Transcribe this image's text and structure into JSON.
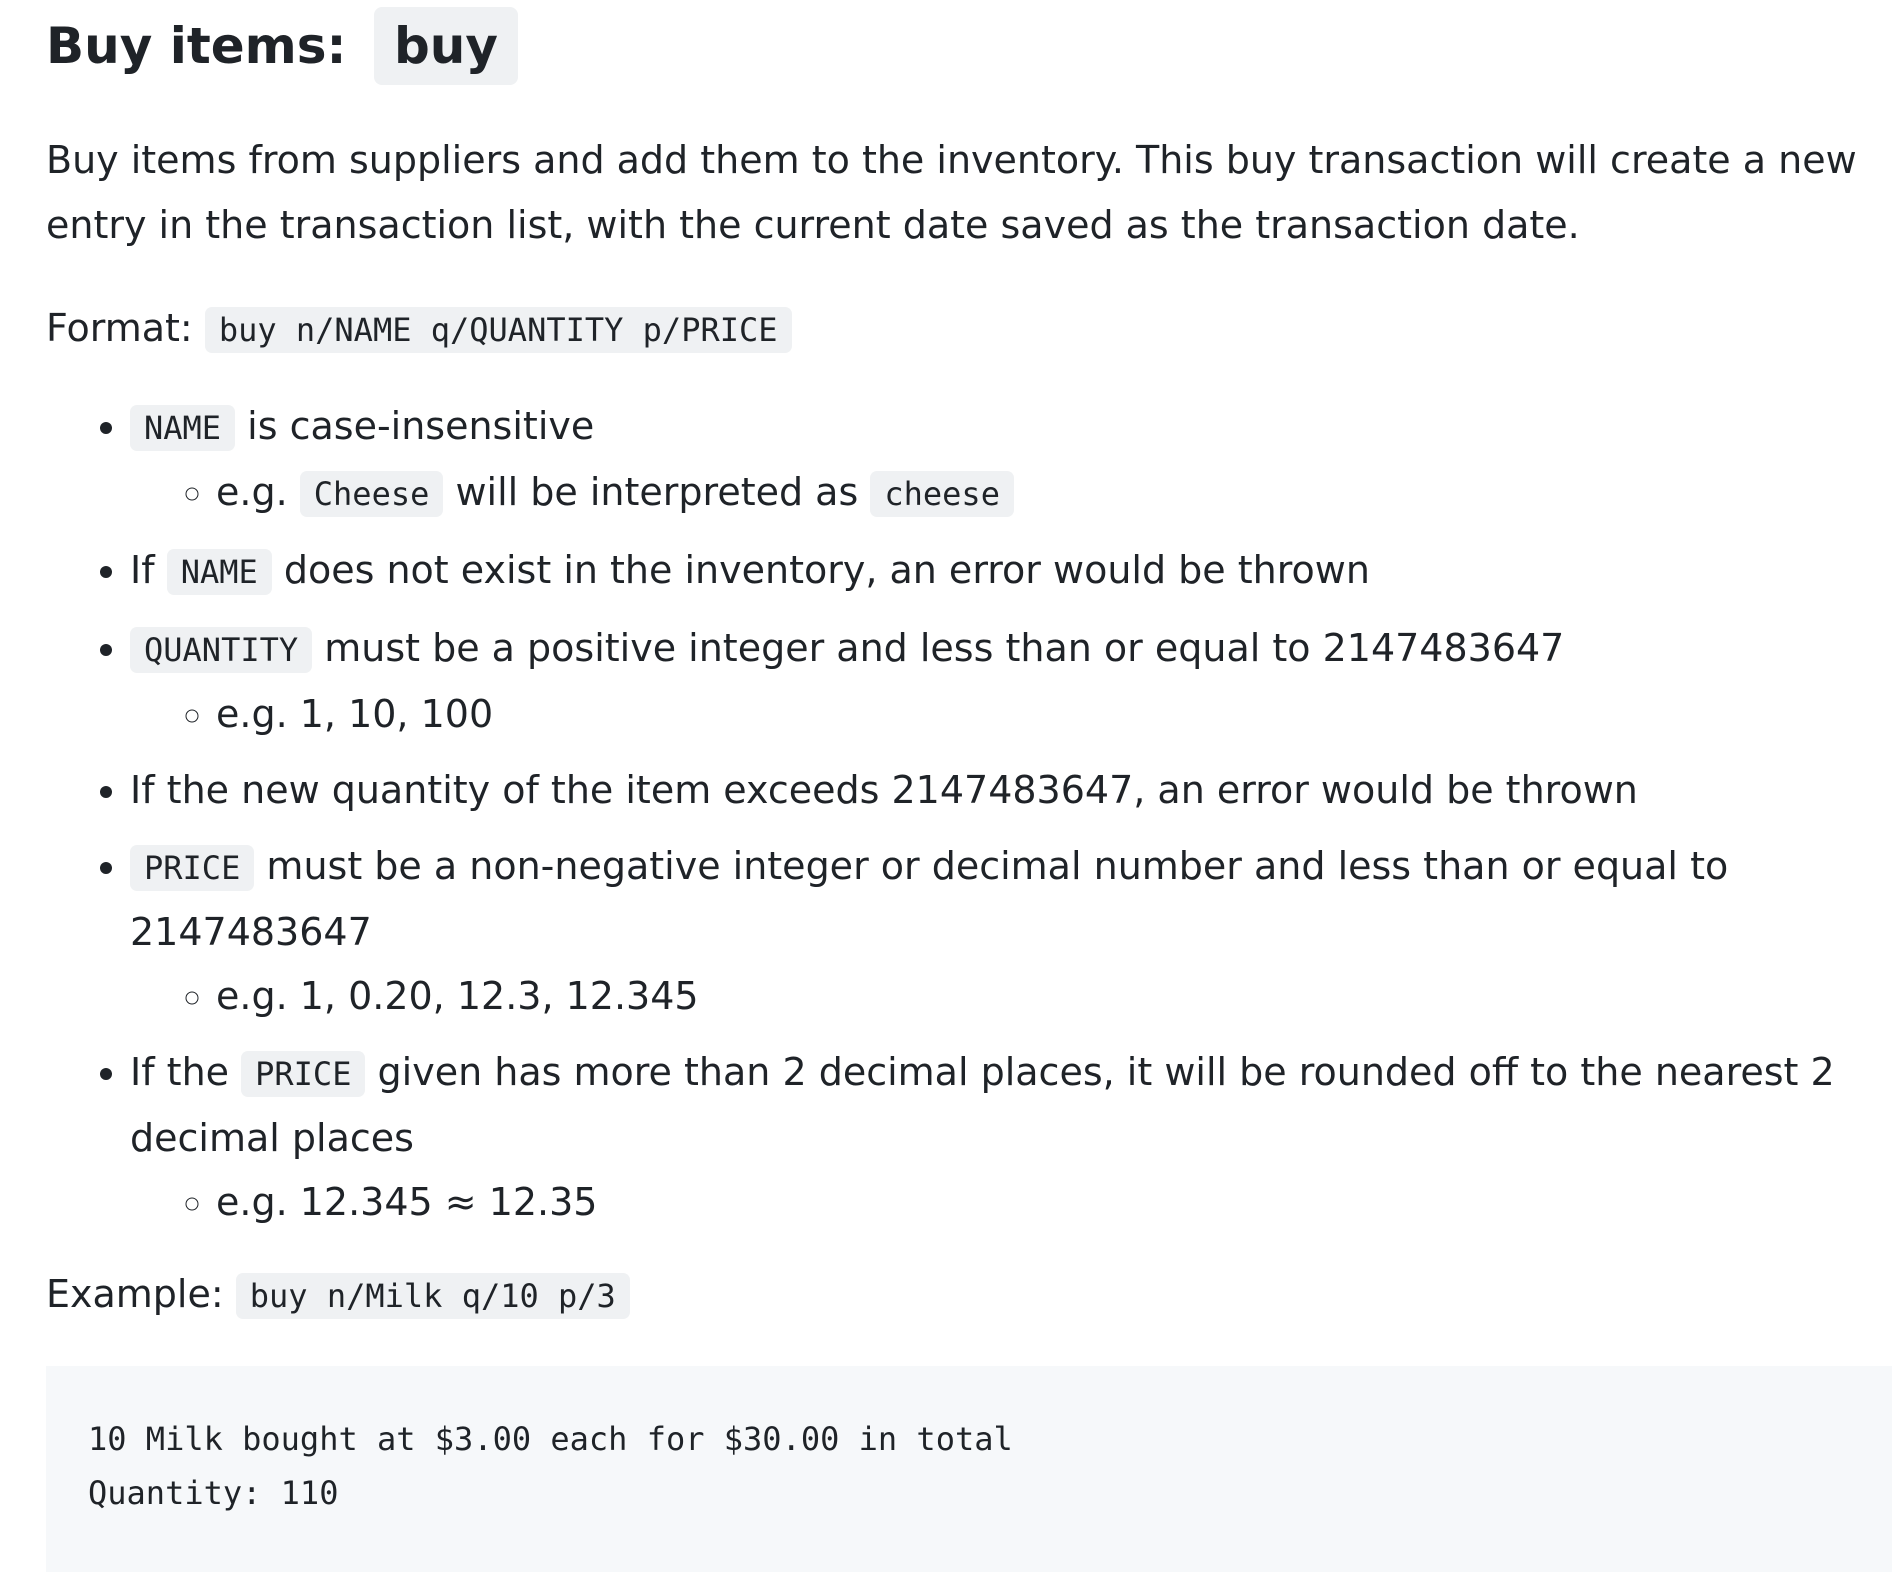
{
  "heading": {
    "text": "Buy items:",
    "command": "buy"
  },
  "description": "Buy items from suppliers and add them to the inventory. This buy transaction will create a new entry in the transaction list, with the current date saved as the transaction date.",
  "format": {
    "label": "Format:",
    "code": "buy n/NAME q/QUANTITY p/PRICE"
  },
  "bullets": {
    "b1": {
      "code": "NAME",
      "text": "is case-insensitive",
      "sub": {
        "prefix": "e.g.",
        "code1": "Cheese",
        "middle": "will be interpreted as",
        "code2": "cheese"
      }
    },
    "b2": {
      "prefix": "If",
      "code": "NAME",
      "text": "does not exist in the inventory, an error would be thrown"
    },
    "b3": {
      "code": "QUANTITY",
      "text": "must be a positive integer and less than or equal to 2147483647",
      "sub": "e.g. 1, 10, 100"
    },
    "b4": {
      "text": "If the new quantity of the item exceeds 2147483647, an error would be thrown"
    },
    "b5": {
      "code": "PRICE",
      "text": "must be a non-negative integer or decimal number and less than or equal to 2147483647",
      "sub": "e.g. 1, 0.20, 12.3, 12.345"
    },
    "b6": {
      "prefix": "If the",
      "code": "PRICE",
      "text": "given has more than 2 decimal places, it will be rounded off to the nearest 2 decimal places",
      "sub": "e.g. 12.345 ≈ 12.35"
    }
  },
  "example": {
    "label": "Example:",
    "code": "buy n/Milk q/10 p/3"
  },
  "output": {
    "line1": "10 Milk bought at $3.00 each for $30.00 in total",
    "line2": "Quantity: 110"
  }
}
